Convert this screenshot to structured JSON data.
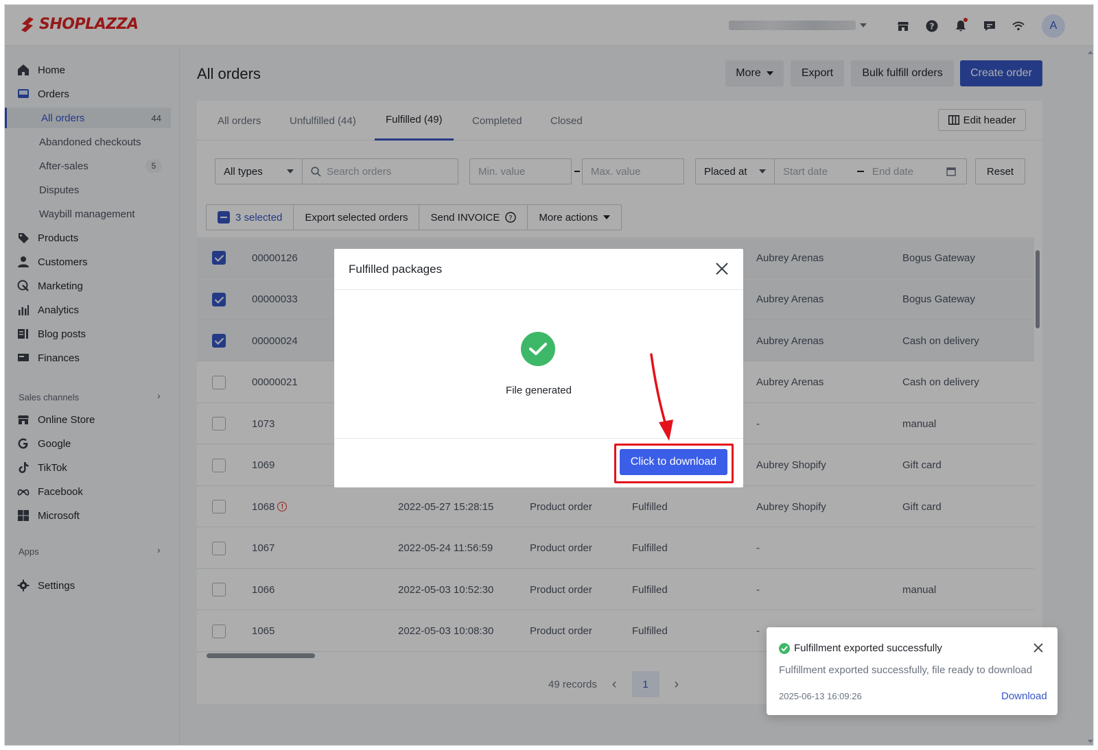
{
  "brand": {
    "name": "SHOPLAZZA",
    "color": "#e02424"
  },
  "topbar": {
    "icons": [
      "store-icon",
      "help-icon",
      "bell-icon",
      "chat-icon",
      "wifi-icon"
    ],
    "avatar_initial": "A"
  },
  "sidebar": {
    "items": [
      {
        "label": "Home",
        "icon": "home-icon"
      },
      {
        "label": "Orders",
        "icon": "orders-icon"
      },
      {
        "label": "Products",
        "icon": "tag-icon"
      },
      {
        "label": "Customers",
        "icon": "person-icon"
      },
      {
        "label": "Marketing",
        "icon": "megaphone-icon"
      },
      {
        "label": "Analytics",
        "icon": "bar-chart-icon"
      },
      {
        "label": "Blog posts",
        "icon": "blog-icon"
      },
      {
        "label": "Finances",
        "icon": "finances-icon"
      }
    ],
    "order_subitems": [
      {
        "label": "All orders",
        "count": "44"
      },
      {
        "label": "Abandoned checkouts",
        "count": ""
      },
      {
        "label": "After-sales",
        "count": "5"
      },
      {
        "label": "Disputes",
        "count": ""
      },
      {
        "label": "Waybill management",
        "count": ""
      }
    ],
    "sales_channels_label": "Sales channels",
    "channels": [
      {
        "label": "Online Store",
        "icon": "store-icon"
      },
      {
        "label": "Google",
        "icon": "google-icon"
      },
      {
        "label": "TikTok",
        "icon": "tiktok-icon"
      },
      {
        "label": "Facebook",
        "icon": "meta-icon"
      },
      {
        "label": "Microsoft",
        "icon": "microsoft-icon"
      }
    ],
    "apps_label": "Apps",
    "settings_label": "Settings"
  },
  "header": {
    "title": "All orders",
    "more_label": "More",
    "export_label": "Export",
    "bulk_fulfill_label": "Bulk fulfill orders",
    "create_label": "Create order",
    "primary_color": "#3556c5"
  },
  "tabs": [
    {
      "label": "All orders"
    },
    {
      "label": "Unfulfilled (44)"
    },
    {
      "label": "Fulfilled (49)"
    },
    {
      "label": "Completed"
    },
    {
      "label": "Closed"
    }
  ],
  "edit_header_label": "Edit header",
  "filters": {
    "type_value": "All types",
    "search_placeholder": "Search orders",
    "min_placeholder": "Min. value",
    "max_placeholder": "Max. value",
    "date_field": "Placed at",
    "start_placeholder": "Start date",
    "end_placeholder": "End date",
    "reset_label": "Reset"
  },
  "bulk": {
    "selected_label": "3 selected",
    "export_selected_label": "Export selected orders",
    "send_invoice_label": "Send INVOICE",
    "more_actions_label": "More actions"
  },
  "orders": [
    {
      "id": "00000126",
      "date": "",
      "type": "",
      "status": "",
      "customer": "Aubrey Arenas",
      "gateway": "Bogus Gateway",
      "checked": true,
      "warn": false
    },
    {
      "id": "00000033",
      "date": "",
      "type": "",
      "status": "",
      "customer": "Aubrey Arenas",
      "gateway": "Bogus Gateway",
      "checked": true,
      "warn": false
    },
    {
      "id": "00000024",
      "date": "",
      "type": "",
      "status": "",
      "customer": "Aubrey Arenas",
      "gateway": "Cash on delivery",
      "checked": true,
      "warn": false
    },
    {
      "id": "00000021",
      "date": "",
      "type": "",
      "status": "",
      "customer": "Aubrey Arenas",
      "gateway": "Cash on delivery",
      "checked": false,
      "warn": false
    },
    {
      "id": "1073",
      "date": "",
      "type": "",
      "status": "",
      "customer": "-",
      "gateway": "manual",
      "checked": false,
      "warn": false
    },
    {
      "id": "1069",
      "date": "",
      "type": "",
      "status": "",
      "customer": "Aubrey Shopify",
      "gateway": "Gift card",
      "checked": false,
      "warn": false
    },
    {
      "id": "1068",
      "date": "2022-05-27 15:28:15",
      "type": "Product order",
      "status": "Fulfilled",
      "customer": "Aubrey Shopify",
      "gateway": "Gift card",
      "checked": false,
      "warn": true
    },
    {
      "id": "1067",
      "date": "2022-05-24 11:56:59",
      "type": "Product order",
      "status": "Fulfilled",
      "customer": "-",
      "gateway": "",
      "checked": false,
      "warn": false
    },
    {
      "id": "1066",
      "date": "2022-05-03 10:52:30",
      "type": "Product order",
      "status": "Fulfilled",
      "customer": "-",
      "gateway": "manual",
      "checked": false,
      "warn": false
    },
    {
      "id": "1065",
      "date": "2022-05-03 10:08:30",
      "type": "Product order",
      "status": "Fulfilled",
      "customer": "-",
      "gateway": "",
      "checked": false,
      "warn": false
    }
  ],
  "pagination": {
    "records": "49 records",
    "current_page": "1"
  },
  "modal": {
    "title": "Fulfilled packages",
    "message": "File generated",
    "download_label": "Click to download",
    "highlight_color": "#e3121c"
  },
  "toast": {
    "title": "Fulfillment exported successfully",
    "message": "Fulfillment exported successfully, file ready to download",
    "timestamp": "2025-06-13 16:09:26",
    "link_label": "Download"
  }
}
